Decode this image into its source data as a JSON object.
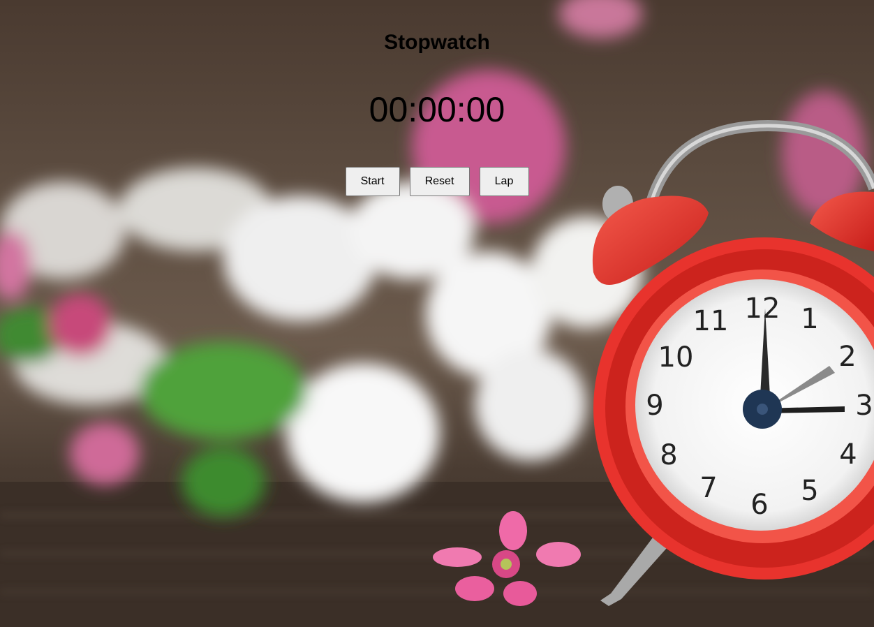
{
  "page": {
    "title": "Stopwatch",
    "time_display": "00:00:00"
  },
  "controls": {
    "start_label": "Start",
    "reset_label": "Reset",
    "lap_label": "Lap"
  },
  "background": {
    "description_icon": "alarm-clock-with-flowers-photo",
    "clock_numbers": [
      "12",
      "1",
      "2",
      "3",
      "4",
      "5",
      "6",
      "7",
      "8",
      "9",
      "10",
      "11"
    ]
  },
  "colors": {
    "clock_red": "#e8332d",
    "button_bg": "#efefef"
  }
}
